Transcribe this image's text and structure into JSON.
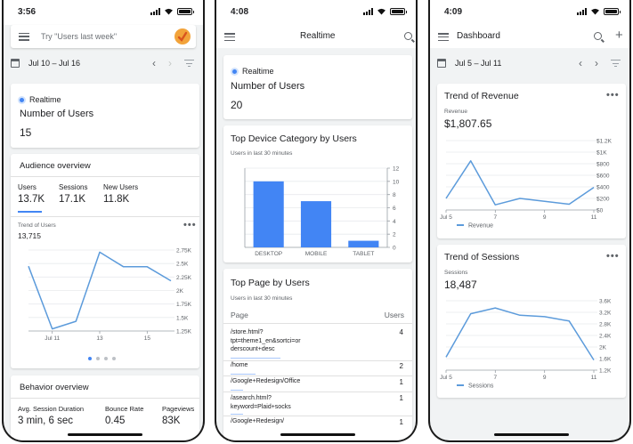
{
  "screen1": {
    "status_time": "3:56",
    "search_placeholder": "Try \"Users last week\"",
    "date_range": "Jul 10 – Jul 16",
    "realtime": {
      "label": "Realtime",
      "metric": "Number of Users",
      "value": "15"
    },
    "audience": {
      "title": "Audience overview",
      "tabs": [
        {
          "label": "Users",
          "value": "13.7K"
        },
        {
          "label": "Sessions",
          "value": "17.1K"
        },
        {
          "label": "New Users",
          "value": "11.8K"
        }
      ],
      "trend_label": "Trend of Users",
      "trend_value": "13,715"
    },
    "behavior": {
      "title": "Behavior overview",
      "metrics": [
        {
          "label": "Avg. Session Duration",
          "value": "3 min, 6 sec"
        },
        {
          "label": "Bounce Rate",
          "value": "0.45"
        },
        {
          "label": "Pageviews",
          "value": "83K"
        }
      ]
    }
  },
  "screen2": {
    "status_time": "4:08",
    "title": "Realtime",
    "realtime": {
      "label": "Realtime",
      "metric": "Number of Users",
      "value": "20"
    },
    "device_card": {
      "title": "Top Device Category by Users",
      "subtitle": "Users in last 30 minutes"
    },
    "page_card": {
      "title": "Top Page by Users",
      "subtitle": "Users in last 30 minutes",
      "col_page": "Page",
      "col_users": "Users",
      "rows": [
        {
          "page": "/store.html?\ntpt=theme1_en&sortci=or\nderscount+desc",
          "users": "4"
        },
        {
          "page": "/home",
          "users": "2"
        },
        {
          "page": "/Google+Redesign/Office",
          "users": "1"
        },
        {
          "page": "/asearch.html?\nkeyword=Plaid+socks",
          "users": "1"
        },
        {
          "page": "/Google+Redesign/",
          "users": "1"
        }
      ]
    }
  },
  "screen3": {
    "status_time": "4:09",
    "title": "Dashboard",
    "date_range": "Jul 5 – Jul 11",
    "revenue_card": {
      "title": "Trend of Revenue",
      "metric_label": "Revenue",
      "metric_value": "$1,807.65"
    },
    "sessions_card": {
      "title": "Trend of Sessions",
      "metric_label": "Sessions",
      "metric_value": "18,487"
    }
  },
  "chart_data": [
    {
      "type": "line",
      "title": "Trend of Users",
      "x": [
        "Jul 10",
        "Jul 11",
        "Jul 12",
        "Jul 13",
        "Jul 14",
        "Jul 15",
        "Jul 16"
      ],
      "x_tick_labels": [
        "Jul 11",
        "13",
        "15"
      ],
      "series": [
        {
          "values": [
            2450,
            1290,
            1430,
            2710,
            2440,
            2440,
            2180
          ]
        }
      ],
      "y_tick_labels": [
        "1.25K",
        "1.5K",
        "1.75K",
        "2K",
        "2.25K",
        "2.5K",
        "2.75K"
      ],
      "y_ticks": [
        1250,
        1500,
        1750,
        2000,
        2250,
        2500,
        2750
      ],
      "ylim": [
        1250,
        2750
      ],
      "color": "#5c9bdb"
    },
    {
      "type": "bar",
      "title": "Top Device Category by Users",
      "categories": [
        "DESKTOP",
        "MOBILE",
        "TABLET"
      ],
      "values": [
        10,
        7,
        1
      ],
      "y_ticks": [
        0,
        2,
        4,
        6,
        8,
        10,
        12
      ],
      "ylim": [
        0,
        12
      ],
      "color": "#4285f4"
    },
    {
      "type": "line",
      "title": "Trend of Revenue",
      "x": [
        "Jul 5",
        "Jul 6",
        "Jul 7",
        "Jul 8",
        "Jul 9",
        "Jul 10",
        "Jul 11"
      ],
      "x_tick_labels": [
        "Jul 5",
        "7",
        "9",
        "11"
      ],
      "series": [
        {
          "name": "Revenue",
          "values": [
            200,
            850,
            90,
            200,
            150,
            100,
            390
          ]
        }
      ],
      "y_tick_labels": [
        "$0",
        "$200",
        "$400",
        "$600",
        "$800",
        "$1K",
        "$1.2K"
      ],
      "y_ticks": [
        0,
        200,
        400,
        600,
        800,
        1000,
        1200
      ],
      "ylim": [
        0,
        1200
      ],
      "color": "#5c9bdb"
    },
    {
      "type": "line",
      "title": "Trend of Sessions",
      "x": [
        "Jul 5",
        "Jul 6",
        "Jul 7",
        "Jul 8",
        "Jul 9",
        "Jul 10",
        "Jul 11"
      ],
      "x_tick_labels": [
        "Jul 5",
        "7",
        "9",
        "11"
      ],
      "series": [
        {
          "name": "Sessions",
          "values": [
            1650,
            3150,
            3350,
            3100,
            3050,
            2900,
            1550
          ]
        }
      ],
      "y_tick_labels": [
        "1.2K",
        "1.6K",
        "2K",
        "2.4K",
        "2.8K",
        "3.2K",
        "3.6K"
      ],
      "y_ticks": [
        1200,
        1600,
        2000,
        2400,
        2800,
        3200,
        3600
      ],
      "ylim": [
        1200,
        3600
      ],
      "color": "#5c9bdb"
    }
  ]
}
